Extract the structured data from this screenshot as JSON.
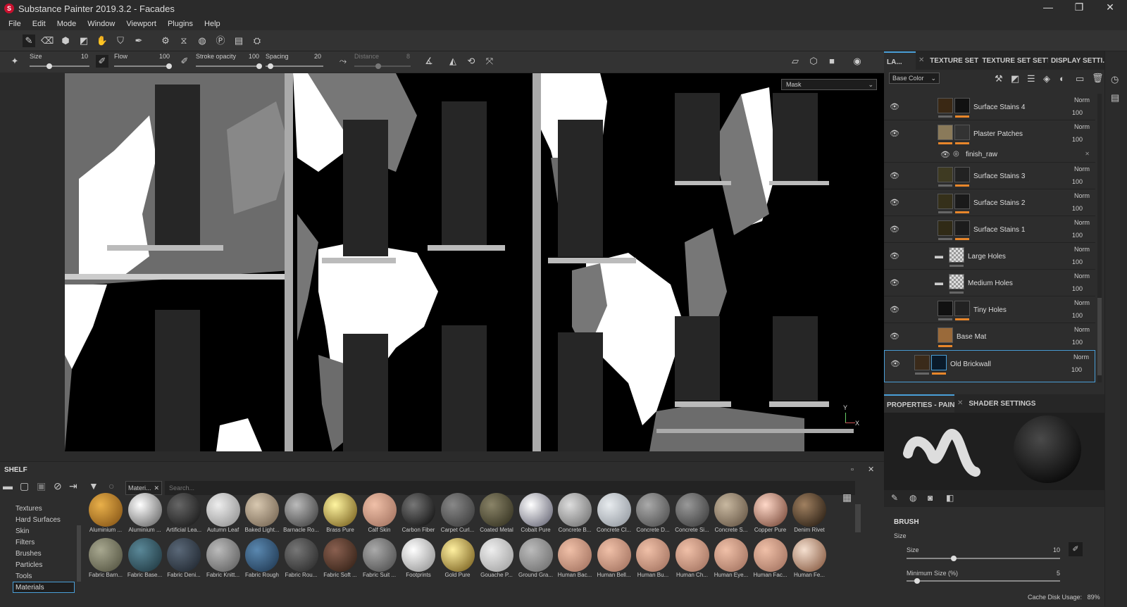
{
  "window": {
    "title": "Substance Painter 2019.3.2 - Facades",
    "logo": "S",
    "minimize": "—",
    "maximize": "❐",
    "close": "✕"
  },
  "menu": [
    "File",
    "Edit",
    "Mode",
    "Window",
    "Viewport",
    "Plugins",
    "Help"
  ],
  "brush_toolbar": {
    "size": {
      "label": "Size",
      "value": "10"
    },
    "flow": {
      "label": "Flow",
      "value": "100"
    },
    "stroke_opacity": {
      "label": "Stroke opacity",
      "value": "100"
    },
    "spacing": {
      "label": "Spacing",
      "value": "20"
    },
    "distance": {
      "label": "Distance",
      "value": "8"
    }
  },
  "viewport": {
    "channel_select": "Mask",
    "axis_y": "Y",
    "axis_x": "X"
  },
  "layers": {
    "tabs": [
      "LA...",
      "TEXTURE SET ...",
      "TEXTURE SET SETTI...",
      "DISPLAY SETTI..."
    ],
    "channel": "Base Color",
    "rows": [
      {
        "name": "Surface Stains 4",
        "blend": "Norm",
        "opacity": "100"
      },
      {
        "name": "Plaster Patches",
        "blend": "Norm",
        "opacity": "100"
      },
      {
        "name": "finish_raw",
        "blend": "",
        "opacity": ""
      },
      {
        "name": "Surface Stains 3",
        "blend": "Norm",
        "opacity": "100"
      },
      {
        "name": "Surface Stains 2",
        "blend": "Norm",
        "opacity": "100"
      },
      {
        "name": "Surface Stains 1",
        "blend": "Norm",
        "opacity": "100"
      },
      {
        "name": "Large Holes",
        "blend": "Norm",
        "opacity": "100"
      },
      {
        "name": "Medium Holes",
        "blend": "Norm",
        "opacity": "100"
      },
      {
        "name": "Tiny Holes",
        "blend": "Norm",
        "opacity": "100"
      },
      {
        "name": "Base Mat",
        "blend": "Norm",
        "opacity": "100"
      },
      {
        "name": "Old Brickwall",
        "blend": "Norm",
        "opacity": "100"
      }
    ]
  },
  "properties": {
    "tabs": [
      "PROPERTIES - PAINT",
      "SHADER SETTINGS"
    ],
    "section": "BRUSH",
    "size_group": "Size",
    "size": {
      "label": "Size",
      "value": "10"
    },
    "min_size": {
      "label": "Minimum Size (%)",
      "value": "5"
    }
  },
  "status": {
    "cache_label": "Cache Disk Usage:",
    "cache_value": "89%"
  },
  "shelf": {
    "title": "SHELF",
    "filter_tag": "Materi...",
    "search_placeholder": "Search...",
    "categories": [
      "Textures",
      "Hard Surfaces",
      "Skin",
      "Filters",
      "Brushes",
      "Particles",
      "Tools",
      "Materials"
    ],
    "selected_category": "Materials",
    "materials_row1": [
      "Aluminium ...",
      "Aluminium ...",
      "Artificial Lea...",
      "Autumn Leaf",
      "Baked Light...",
      "Barnacle Ro...",
      "Brass Pure",
      "Calf Skin",
      "Carbon Fiber",
      "Carpet Curl...",
      "Coated Metal",
      "Cobalt Pure",
      "Concrete B...",
      "Concrete Cl...",
      "Concrete D...",
      "Concrete Si...",
      "Concrete S...",
      "Copper Pure",
      "Denim Rivet"
    ],
    "materials_row2": [
      "Fabric Barn...",
      "Fabric Base...",
      "Fabric Deni...",
      "Fabric Knitt...",
      "Fabric Rough",
      "Fabric Rou...",
      "Fabric Soft ...",
      "Fabric Suit ...",
      "Footprints",
      "Gold Pure",
      "Gouache P...",
      "Ground Gra...",
      "Human Bac...",
      "Human Bell...",
      "Human Bu...",
      "Human Ch...",
      "Human Eye...",
      "Human Fac...",
      "Human Fe..."
    ]
  },
  "colors": {
    "accent": "#4a9fd8",
    "orange": "#e8862a",
    "logo": "#c8102e"
  }
}
